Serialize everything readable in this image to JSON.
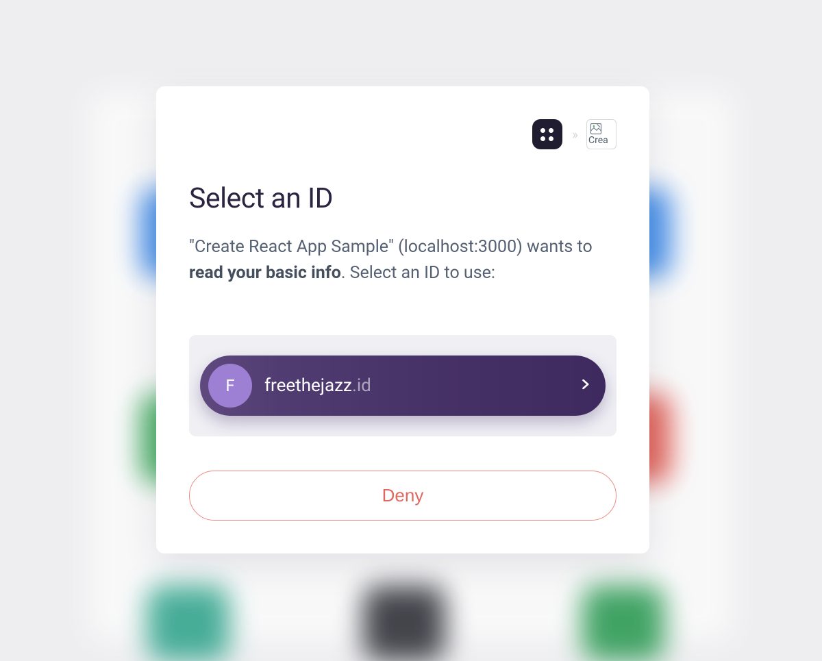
{
  "modal": {
    "title": "Select an ID",
    "desc_prefix": "\"Create React App Sample\" (localhost:3000) wants to ",
    "desc_bold": "read your basic info",
    "desc_suffix": ". Select an ID to use:"
  },
  "header": {
    "transfer_glyph": "»",
    "dest_alt": "Crea"
  },
  "identity": {
    "avatar_letter": "F",
    "name": "freethejazz",
    "suffix": ".id"
  },
  "buttons": {
    "deny": "Deny"
  }
}
